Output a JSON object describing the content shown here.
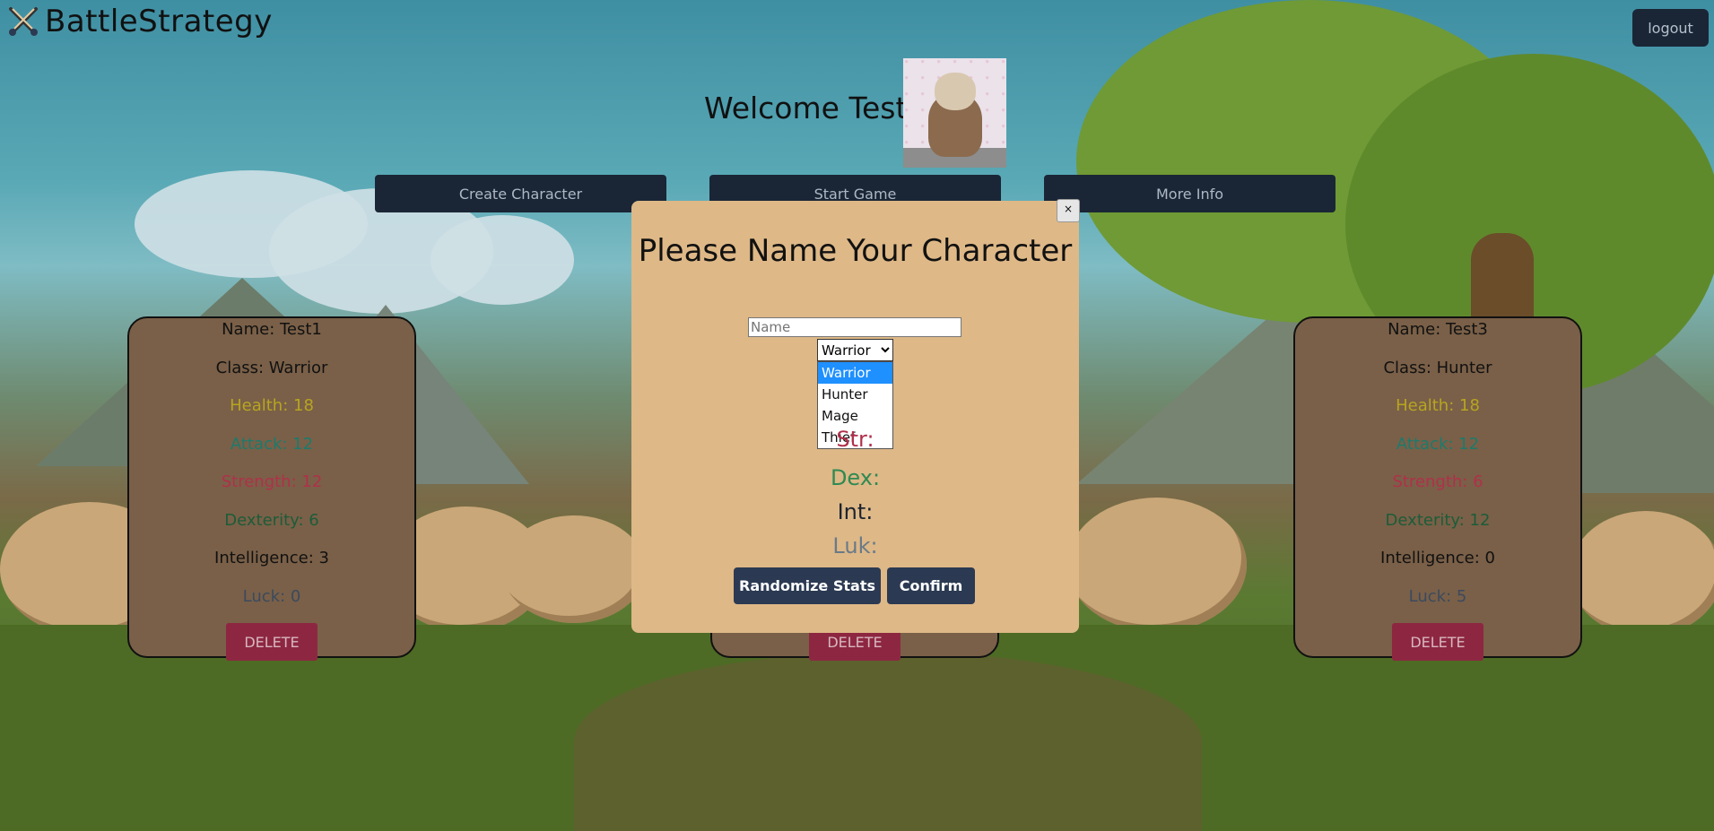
{
  "app": {
    "title": "BattleStrategy"
  },
  "header": {
    "logout_label": "logout"
  },
  "welcome": {
    "text": "Welcome Test"
  },
  "nav": {
    "create_label": "Create Character",
    "start_label": "Start Game",
    "info_label": "More Info"
  },
  "characters": [
    {
      "name": "Name: Test1",
      "class": "Class: Warrior",
      "health": "Health: 18",
      "attack": "Attack: 12",
      "strength": "Strength: 12",
      "dexterity": "Dexterity: 6",
      "intelligence": "Intelligence: 3",
      "luck": "Luck: 0",
      "delete_label": "DELETE"
    },
    {
      "delete_label": "DELETE"
    },
    {
      "name": "Name: Test3",
      "class": "Class: Hunter",
      "health": "Health: 18",
      "attack": "Attack: 12",
      "strength": "Strength: 6",
      "dexterity": "Dexterity: 12",
      "intelligence": "Intelligence: 0",
      "luck": "Luck: 5",
      "delete_label": "DELETE"
    }
  ],
  "modal": {
    "close_label": "×",
    "title": "Please Name Your Character",
    "name_placeholder": "Name",
    "class_selected": "Warrior",
    "class_options": [
      "Warrior",
      "Hunter",
      "Mage",
      "Thief"
    ],
    "stat_labels": {
      "str": "Str:",
      "dex": "Dex:",
      "int": "Int:",
      "luk": "Luk:"
    },
    "randomize_label": "Randomize Stats",
    "confirm_label": "Confirm"
  },
  "colors": {
    "button_dark": "#1a2636",
    "modal_bg": "#deb887",
    "card_bg": "#7a6048",
    "delete_red": "#8d2741",
    "dropdown_highlight": "#1e90ff"
  },
  "icons": {
    "brand": "crossed-swords-icon",
    "close": "close-icon"
  }
}
